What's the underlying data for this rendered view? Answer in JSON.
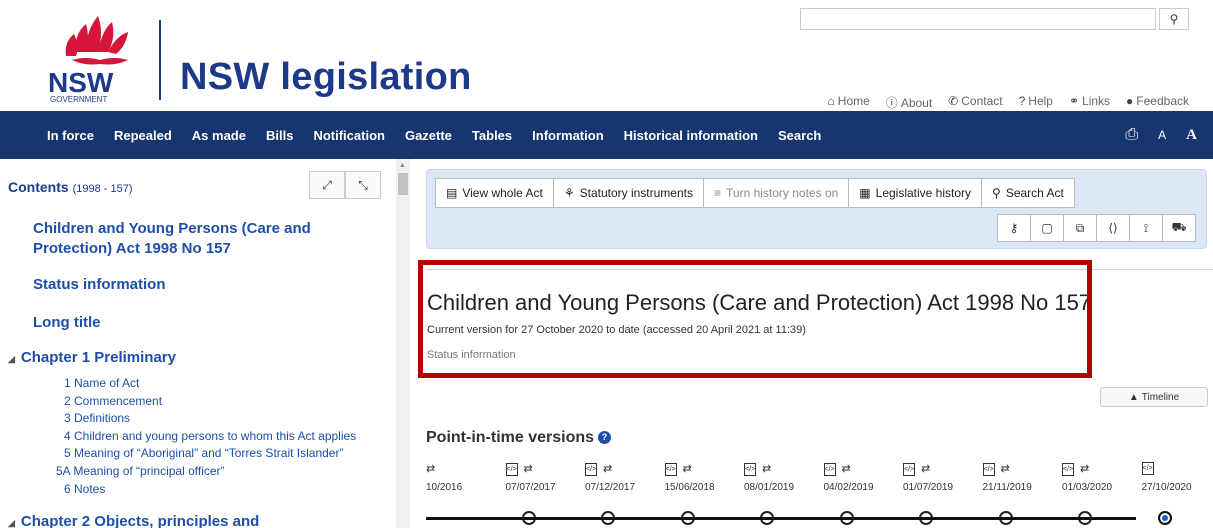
{
  "header": {
    "logo_text": "NSW",
    "logo_subtext": "GOVERNMENT",
    "site_title": "NSW legislation",
    "search_placeholder": "",
    "top_links": [
      {
        "icon": "home-icon",
        "glyph": "⌂",
        "label": "Home"
      },
      {
        "icon": "info-icon",
        "glyph": "ⓘ",
        "label": "About"
      },
      {
        "icon": "phone-icon",
        "glyph": "✆",
        "label": "Contact"
      },
      {
        "icon": "help-icon",
        "glyph": "?",
        "label": "Help"
      },
      {
        "icon": "link-icon",
        "glyph": "⚭",
        "label": "Links"
      },
      {
        "icon": "feedback-icon",
        "glyph": "●",
        "label": "Feedback"
      }
    ]
  },
  "nav": {
    "items": [
      "In force",
      "Repealed",
      "As made",
      "Bills",
      "Notification",
      "Gazette",
      "Tables",
      "Information",
      "Historical information",
      "Search"
    ],
    "font_small": "A",
    "font_large": "A"
  },
  "sidebar": {
    "contents_label": "Contents",
    "contents_sub": "(1998 - 157)",
    "act_link_line1": "Children and Young Persons (Care and",
    "act_link_line2": "Protection) Act 1998 No 157",
    "status_information": "Status information",
    "long_title": "Long title",
    "chapter1": "Chapter 1 Preliminary",
    "chapter1_items": [
      "1 Name of Act",
      "2 Commencement",
      "3 Definitions",
      "4 Children and young persons to whom this Act applies",
      "5 Meaning of “Aboriginal” and “Torres Strait Islander”",
      "5A Meaning of “principal officer”",
      "6 Notes"
    ],
    "chapter2": "Chapter 2 Objects, principles and"
  },
  "toolbar": {
    "buttons": [
      {
        "icon": "document-icon",
        "glyph": "▤",
        "label": "View whole Act"
      },
      {
        "icon": "sitemap-icon",
        "glyph": "⚘",
        "label": "Statutory instruments"
      },
      {
        "icon": "list-icon",
        "glyph": "≡",
        "label": "Turn history notes on"
      },
      {
        "icon": "calendar-icon",
        "glyph": "▦",
        "label": "Legislative history"
      },
      {
        "icon": "search-icon",
        "glyph": "⚲",
        "label": "Search Act"
      }
    ],
    "icons": [
      {
        "name": "key-icon",
        "glyph": "⚷"
      },
      {
        "name": "pdf-icon",
        "glyph": "▢"
      },
      {
        "name": "copy-icon",
        "glyph": "⧉"
      },
      {
        "name": "xml-icon",
        "glyph": "⟨⟩"
      },
      {
        "name": "rss-icon",
        "glyph": "⟟"
      },
      {
        "name": "truck-icon",
        "glyph": "⛟"
      }
    ]
  },
  "content": {
    "act_title": "Children and Young Persons (Care and Protection) Act 1998 No 157",
    "current_version": "Current version for 27 October 2020 to date (accessed 20 April 2021 at 11:39)",
    "status_information": "Status information",
    "timeline_button": "Timeline",
    "pit_title": "Point-in-time versions",
    "versions": [
      "10/2016",
      "07/07/2017",
      "07/12/2017",
      "15/06/2018",
      "08/01/2019",
      "04/02/2019",
      "01/07/2019",
      "21/11/2019",
      "01/03/2020",
      "27/10/2020"
    ]
  },
  "colors": {
    "brand_blue": "#17356f",
    "link_blue": "#1d4fa8",
    "highlight_red": "#b30000",
    "waratah_red": "#d7153a"
  }
}
